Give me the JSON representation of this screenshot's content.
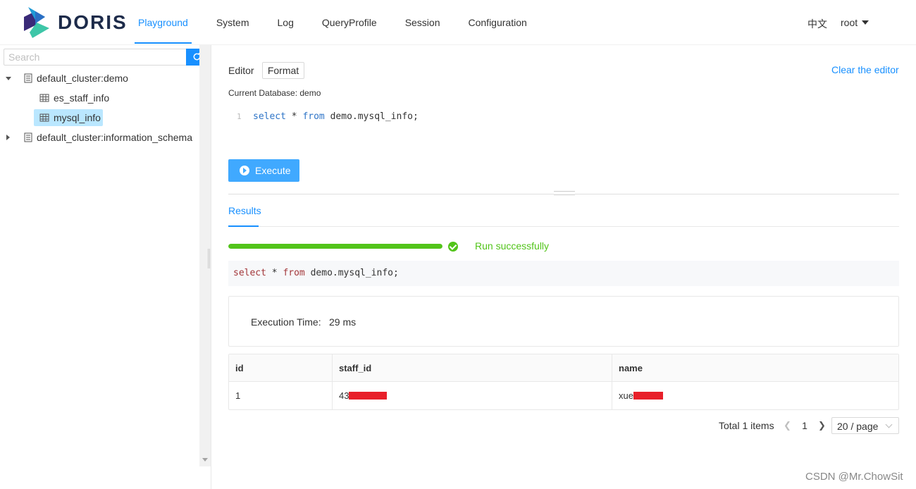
{
  "brand": {
    "name": "DORIS"
  },
  "nav": {
    "items": [
      "Playground",
      "System",
      "Log",
      "QueryProfile",
      "Session",
      "Configuration"
    ],
    "active": "Playground"
  },
  "header": {
    "language": "中文",
    "user": "root"
  },
  "sidebar": {
    "search_placeholder": "Search",
    "tree": {
      "db1": "default_cluster:demo",
      "table1": "es_staff_info",
      "table2": "mysql_info",
      "db2": "default_cluster:information_schema"
    }
  },
  "editor": {
    "label": "Editor",
    "format_button": "Format",
    "clear_link": "Clear the editor",
    "current_db": "Current Database: demo",
    "line_number": "1",
    "code": {
      "kw_select": "select",
      "star": " * ",
      "kw_from": "from",
      "rest": " demo.mysql_info;"
    },
    "execute_button": "Execute"
  },
  "results": {
    "tab_label": "Results",
    "progress_percent": 100,
    "status": "Run successfully",
    "sql_echo": {
      "kw_select": "select",
      "star": " * ",
      "kw_from": "from",
      "rest": " demo.mysql_info;"
    },
    "exec_time_label": "Execution Time:",
    "exec_time_value": "29 ms",
    "table": {
      "columns": [
        "id",
        "staff_id",
        "name"
      ],
      "rows": [
        {
          "id": "1",
          "staff_id": "43",
          "name": "xue"
        }
      ]
    },
    "pagination": {
      "total": "Total 1 items",
      "current_page": "1",
      "page_size": "20 / page"
    }
  },
  "colors": {
    "accent": "#1890ff",
    "success": "#52c41a",
    "redaction": "#e8202a"
  },
  "watermark": "CSDN @Mr.ChowSit"
}
